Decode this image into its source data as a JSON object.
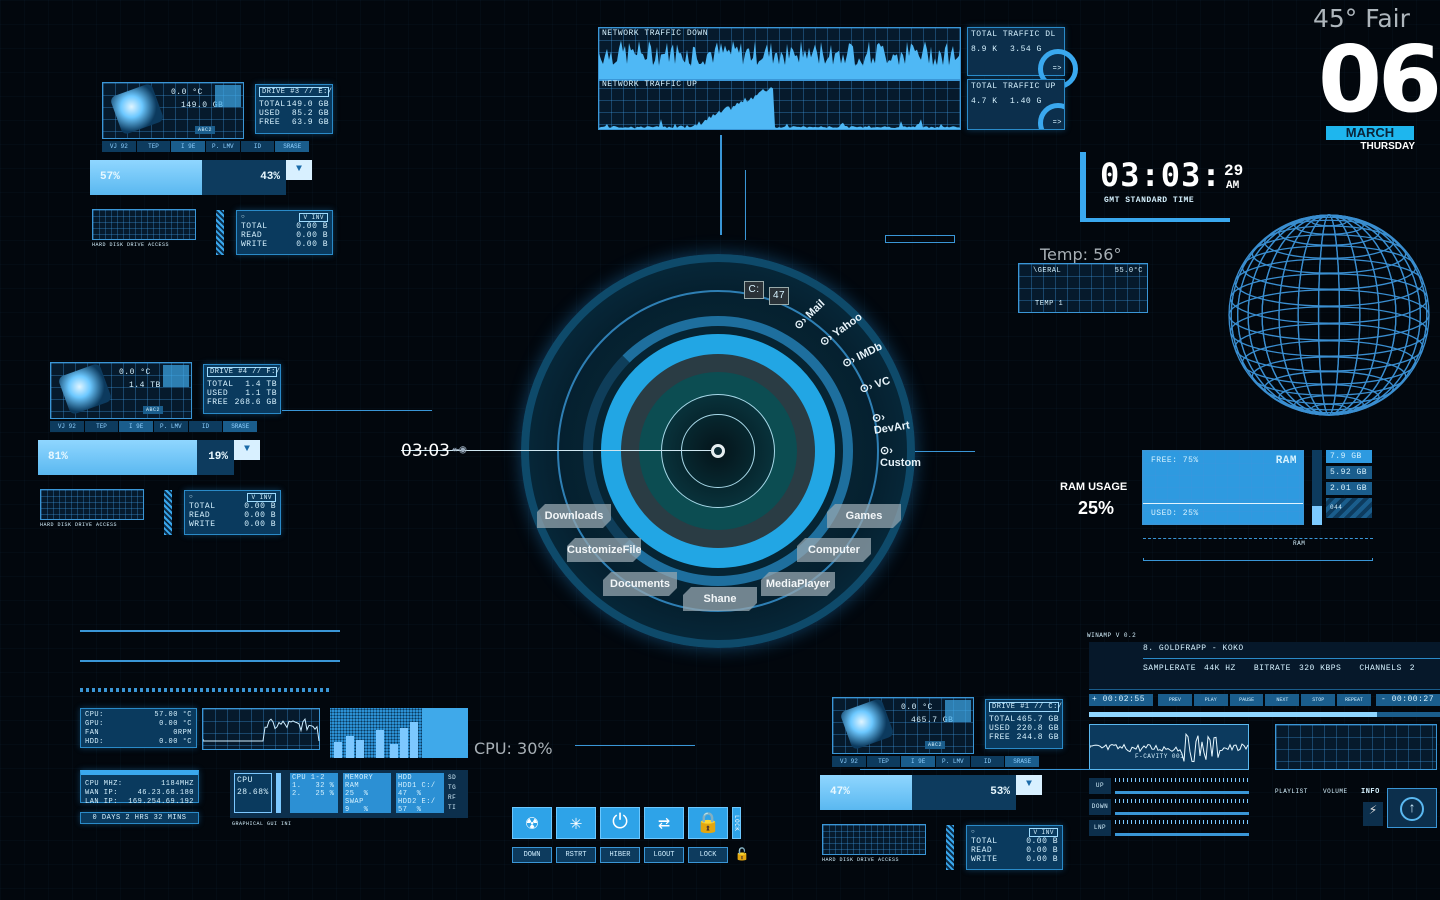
{
  "weather": {
    "text": "45° Fair"
  },
  "date": {
    "day": "06",
    "month": "MARCH",
    "weekday": "THURSDAY"
  },
  "clock": {
    "time": "03:03:",
    "seconds": "29",
    "ampm": "AM",
    "zone": "GMT STANDARD TIME"
  },
  "temp": {
    "label": "Temp: 56°",
    "panel_left": "\\GERAL",
    "panel_value": "55.0°C",
    "sensor": "TEMP 1"
  },
  "network": {
    "down_title": "NETWORK TRAFFIC DOWN",
    "up_title": "NETWORK TRAFFIC UP",
    "dl_title": "TOTAL TRAFFIC DL",
    "dl_rate": "8.9 K",
    "dl_total": "3.54 G",
    "ul_title": "TOTAL TRAFFIC UP",
    "ul_rate": "4.7 K",
    "ul_total": "1.40 G",
    "arrow": "=>"
  },
  "drive_tabs": [
    "VJ 92",
    "TEP",
    "I 9E",
    "P. LMV",
    "ID",
    "SRASE"
  ],
  "drives": [
    {
      "name": "DRIVE #3 // E:/",
      "temp": "0.0 °C",
      "size": "149.0 GB",
      "total": "149.0 GB",
      "used": "85.2 GB",
      "free": "63.9 GB",
      "used_pct": "57%",
      "free_pct": "43%",
      "used_fraction": 0.57,
      "access_label": "HARD DISK DRIVE ACCESS",
      "io_mode": "V INV",
      "io_total": "0.00 B",
      "io_read": "0.00 B",
      "io_write": "0.00 B",
      "badge": "ABC2"
    },
    {
      "name": "DRIVE #4 // F:/",
      "temp": "0.0 °C",
      "size": "1.4 TB",
      "total": "1.4 TB",
      "used": "1.1 TB",
      "free": "268.6 GB",
      "used_pct": "81%",
      "free_pct": "19%",
      "used_fraction": 0.81,
      "access_label": "HARD DISK DRIVE ACCESS",
      "io_mode": "V INV",
      "io_total": "0.00 B",
      "io_read": "0.00 B",
      "io_write": "0.00 B",
      "badge": "ABC2"
    },
    {
      "name": "DRIVE #1 // C:/",
      "temp": "0.0 °C",
      "size": "465.7 GB",
      "total": "465.7 GB",
      "used": "220.8 GB",
      "free": "244.8 GB",
      "used_pct": "47%",
      "free_pct": "53%",
      "used_fraction": 0.47,
      "access_label": "HARD DISK DRIVE ACCESS",
      "io_mode": "V INV",
      "io_total": "0.00 B",
      "io_read": "0.00 B",
      "io_write": "0.00 B",
      "badge": "ABC2"
    }
  ],
  "io_labels": {
    "total": "TOTAL",
    "read": "READ",
    "write": "WRITE",
    "total_k": "TOTAL",
    "used_k": "USED",
    "free_k": "FREE"
  },
  "hub": {
    "clock": "03:03",
    "drive_letter": "C:",
    "drive_value": "47",
    "links": [
      "Mail",
      "Yahoo",
      "IMDb",
      "VC",
      "DevArt",
      "Custom"
    ],
    "folders": [
      "Downloads",
      "CustomizeFile",
      "Documents",
      "Shane",
      "MediaPlayer",
      "Computer",
      "Games"
    ]
  },
  "ram": {
    "title": "RAM USAGE",
    "percent": "25%",
    "panel_title": "RAM",
    "free": "FREE: 75%",
    "used": "USED: 25%",
    "total": "7.9 GB",
    "free_gb": "5.92 GB",
    "used_gb": "2.01 GB",
    "small": "044",
    "footer": "RAM"
  },
  "sensors": [
    {
      "k": "CPU:",
      "v": "57.00 °C"
    },
    {
      "k": "GPU:",
      "v": "0.00 °C"
    },
    {
      "k": "FAN",
      "v": "0RPM"
    },
    {
      "k": "HDD:",
      "v": "0.00 °C"
    }
  ],
  "sysinfo": [
    {
      "k": "CPU MHZ:",
      "v": "1184MHZ"
    },
    {
      "k": "WAN IP:",
      "v": "46.23.68.180"
    },
    {
      "k": "LAN IP:",
      "v": "169.254.69.192"
    }
  ],
  "uptime": "0 DAYS 2 HRS 32 MINS",
  "cpu": {
    "label": "CPU: 30%",
    "box_title": "CPU",
    "box_value": "28.68%",
    "cores_title": "CPU 1-2",
    "core1": "1.   32 %",
    "core2": "2.   25 %",
    "mem_title": "MEMORY",
    "ram_label": "RAM",
    "ram": "25  %",
    "swap_label": "SWAP",
    "swap": "9   %",
    "hdd_title": "HDD",
    "hdd1": "HDD1 C:/",
    "hdd1_v": "47  %",
    "hdd2": "HDD2 E:/",
    "hdd2_v": "57  %",
    "footer": "GRAPHICAL GUI INI",
    "side": [
      "SD",
      "TG",
      "RF",
      "TI"
    ]
  },
  "power": [
    {
      "label": "DOWN",
      "icon": "radiation-icon",
      "glyph": "☢"
    },
    {
      "label": "RSTRT",
      "icon": "restart-icon",
      "glyph": "✳"
    },
    {
      "label": "HIBER",
      "icon": "power-icon",
      "glyph": "⏻"
    },
    {
      "label": "LGOUT",
      "icon": "logout-arrows-icon",
      "glyph": "⇄"
    },
    {
      "label": "LOCK",
      "icon": "lock-icon",
      "glyph": "🔒"
    }
  ],
  "power_lock": {
    "label": "LOCK",
    "glyph": "🔓"
  },
  "winamp": {
    "title": "WINAMP V 0.2",
    "track": "8. GOLDFRAPP - KOKO",
    "samplerate_k": "SAMPLERATE",
    "samplerate": "44K HZ",
    "bitrate_k": "BITRATE",
    "bitrate": "320 KBPS",
    "channels_k": "CHANNELS",
    "channels": "2",
    "elapsed": "+ 00:02:55",
    "remaining": "- 00:00:27",
    "progress": 0.82,
    "buttons": [
      "PREV",
      "PLAY",
      "PAUSE",
      "NEXT",
      "STOP",
      "REPEAT"
    ],
    "viz": "F-CAVITY 001",
    "sliders": [
      "UP",
      "DOWN",
      "LNP"
    ],
    "playlist": "PLAYLIST",
    "volume": "VOLUME",
    "info": "INFO"
  }
}
